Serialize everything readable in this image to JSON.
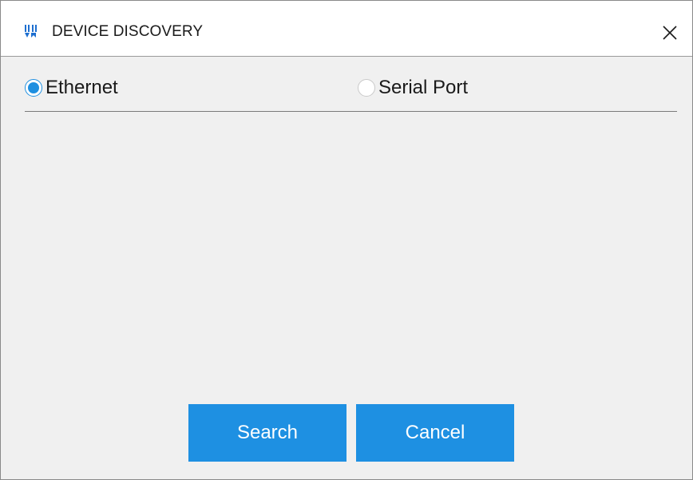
{
  "window": {
    "title": "DEVICE DISCOVERY"
  },
  "icons": {
    "app": "honeywell-logo-icon",
    "close": "close-icon"
  },
  "connection": {
    "options": [
      {
        "label": "Ethernet",
        "selected": true
      },
      {
        "label": "Serial Port",
        "selected": false
      }
    ]
  },
  "buttons": {
    "search_label": "Search",
    "cancel_label": "Cancel"
  },
  "colors": {
    "accent": "#1e90e2",
    "window_bg": "#f0f0f0",
    "titlebar_bg": "#ffffff"
  }
}
